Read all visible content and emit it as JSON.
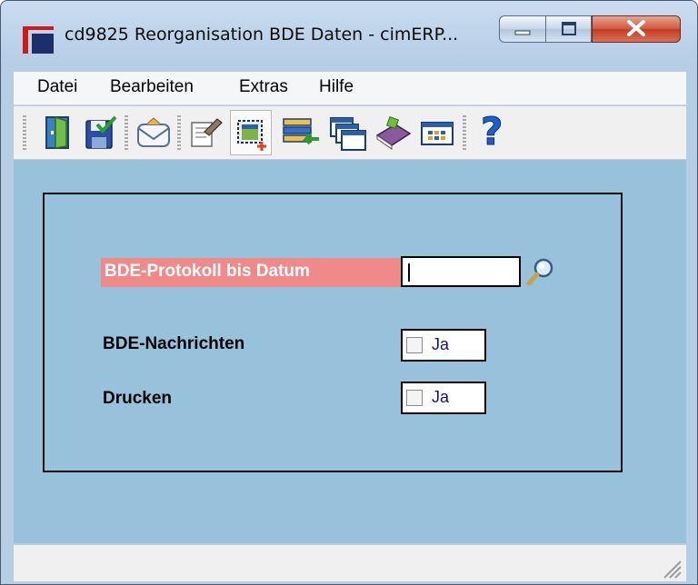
{
  "window": {
    "title": "cd9825 Reorganisation BDE Daten - cimERP..."
  },
  "menu": {
    "items": [
      "Datei",
      "Bearbeiten",
      "Extras",
      "Hilfe"
    ]
  },
  "toolbar": {
    "icons": [
      "exit-door-icon",
      "save-icon",
      "mail-icon",
      "edit-document-icon",
      "new-record-icon",
      "transfer-list-icon",
      "copy-windows-icon",
      "book-icon",
      "grid-view-icon",
      "help-icon"
    ],
    "help_glyph": "?"
  },
  "form": {
    "bde_protokoll": {
      "label": "BDE-Protokoll bis Datum",
      "value": "",
      "required_color": "#f08a8a"
    },
    "bde_nachrichten": {
      "label": "BDE-Nachrichten",
      "checkbox_label": "Ja",
      "checked": false
    },
    "drucken": {
      "label": "Drucken",
      "checkbox_label": "Ja",
      "checked": false
    }
  },
  "colors": {
    "workspace": "#98c2dc",
    "checkbox_text": "#12128f",
    "close_button": "#c13b20"
  }
}
